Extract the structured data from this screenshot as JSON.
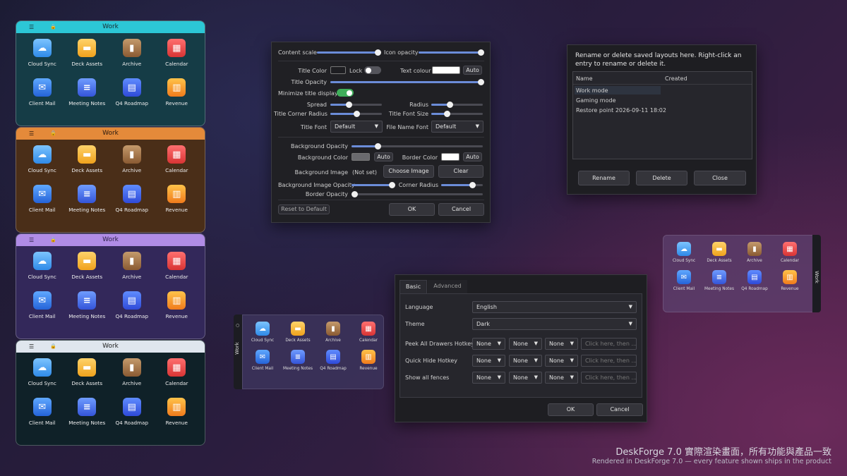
{
  "fences": [
    {
      "title": "Work",
      "menu": "☰",
      "lock": "🔒",
      "bar_color": "#2cc7d6",
      "bg_color": "#153c46",
      "title_color": "#1a2a30"
    },
    {
      "title": "Work",
      "menu": "☰",
      "lock": "🔒",
      "bar_color": "#e48a3a",
      "bg_color": "#4a2e18",
      "title_color": "#2a1a10"
    },
    {
      "title": "Work",
      "menu": "☰",
      "lock": "🔒",
      "bar_color": "#b08ce6",
      "bg_color": "#33285a",
      "title_color": "#2a1f45"
    },
    {
      "title": "Work",
      "menu": "☰",
      "lock": "🔒",
      "bar_color": "#dfe6ee",
      "bg_color": "#0f2128",
      "title_color": "#222"
    }
  ],
  "icons": [
    {
      "label": "Cloud Sync",
      "icon": "cloud-icon",
      "glyph": "☁"
    },
    {
      "label": "Deck Assets",
      "icon": "folder-icon",
      "glyph": "▬"
    },
    {
      "label": "Archive",
      "icon": "archive-icon",
      "glyph": "▮"
    },
    {
      "label": "Calendar",
      "icon": "calendar-icon",
      "glyph": "▦"
    },
    {
      "label": "Client Mail",
      "icon": "mail-icon",
      "glyph": "✉"
    },
    {
      "label": "Meeting Notes",
      "icon": "notes-icon",
      "glyph": "≡"
    },
    {
      "label": "Q4 Roadmap",
      "icon": "roadmap-icon",
      "glyph": "▤"
    },
    {
      "label": "Revenue",
      "icon": "chart-icon",
      "glyph": "▥"
    }
  ],
  "appearance": {
    "content_scale": "Content scale",
    "icon_opacity": "Icon opacity",
    "title_color": "Title Color",
    "lock": "Lock",
    "text_colour": "Text colour",
    "auto": "Auto",
    "title_opacity": "Title Opacity",
    "minimize_title": "Minimize title display",
    "spread": "Spread",
    "radius": "Radius",
    "title_corner_radius": "Title Corner Radius",
    "title_font_size": "Title Font Size",
    "title_font": "Title Font",
    "title_font_value": "Default",
    "file_name_font": "File Name Font",
    "file_name_font_value": "Default",
    "bg_opacity": "Background Opacity",
    "bg_color": "Background Color",
    "auto2": "Auto",
    "border_color": "Border Color",
    "auto3": "Auto",
    "bg_image": "Background Image",
    "not_set": "(Not set)",
    "choose_image": "Choose Image",
    "clear": "Clear",
    "bg_image_opacity": "Background Image Opacity",
    "corner_radius": "Corner Radius",
    "border_opacity": "Border Opacity",
    "reset": "Reset to Default",
    "ok": "OK",
    "cancel": "Cancel",
    "sliders": {
      "content_scale": 0.95,
      "icon_opacity": 1.0,
      "title_opacity": 1.0,
      "spread": 0.35,
      "radius": 0.35,
      "title_corner_radius": 0.5,
      "title_font_size": 0.3,
      "bg_opacity": 0.2,
      "bg_image_opacity": 0.98,
      "corner_radius": 0.75,
      "border_opacity": 0.0
    }
  },
  "layouts": {
    "message": "Rename or delete saved layouts here. Right-click an entry to rename or delete it.",
    "col_name": "Name",
    "col_created": "Created",
    "rows": [
      "Work mode",
      "Gaming mode",
      "Restore point 2026-09-11 18:02"
    ],
    "rename": "Rename",
    "delete": "Delete",
    "close": "Close"
  },
  "settings": {
    "tab_basic": "Basic",
    "tab_advanced": "Advanced",
    "language": "Language",
    "language_value": "English",
    "theme": "Theme",
    "theme_value": "Dark",
    "rows": [
      {
        "label": "Peek All Drawers Hotkey",
        "a": "None",
        "b": "None",
        "c": "None",
        "ph": "Click here, then ..."
      },
      {
        "label": "Quick Hide Hotkey",
        "a": "None",
        "b": "None",
        "c": "None",
        "ph": "Click here, then ..."
      },
      {
        "label": "Show all fences",
        "a": "None",
        "b": "None",
        "c": "None",
        "ph": "Click here, then ..."
      }
    ],
    "ok": "OK",
    "cancel": "Cancel"
  },
  "mini_left": {
    "tab": "Work",
    "dot": "○"
  },
  "mini_right": {
    "tab": "Work"
  },
  "footer": {
    "line1": "DeskForge 7.0 實際渲染畫面，所有功能與產品一致",
    "line2": "Rendered in DeskForge 7.0 — every feature shown ships in the product"
  }
}
